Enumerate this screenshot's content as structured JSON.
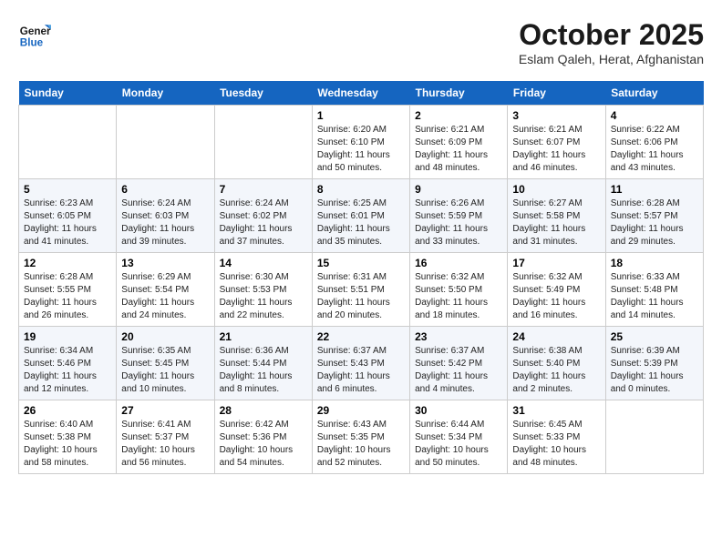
{
  "header": {
    "logo_general": "General",
    "logo_blue": "Blue",
    "title": "October 2025",
    "subtitle": "Eslam Qaleh, Herat, Afghanistan"
  },
  "days_of_week": [
    "Sunday",
    "Monday",
    "Tuesday",
    "Wednesday",
    "Thursday",
    "Friday",
    "Saturday"
  ],
  "weeks": [
    [
      {
        "day": "",
        "info": ""
      },
      {
        "day": "",
        "info": ""
      },
      {
        "day": "",
        "info": ""
      },
      {
        "day": "1",
        "info": "Sunrise: 6:20 AM\nSunset: 6:10 PM\nDaylight: 11 hours\nand 50 minutes."
      },
      {
        "day": "2",
        "info": "Sunrise: 6:21 AM\nSunset: 6:09 PM\nDaylight: 11 hours\nand 48 minutes."
      },
      {
        "day": "3",
        "info": "Sunrise: 6:21 AM\nSunset: 6:07 PM\nDaylight: 11 hours\nand 46 minutes."
      },
      {
        "day": "4",
        "info": "Sunrise: 6:22 AM\nSunset: 6:06 PM\nDaylight: 11 hours\nand 43 minutes."
      }
    ],
    [
      {
        "day": "5",
        "info": "Sunrise: 6:23 AM\nSunset: 6:05 PM\nDaylight: 11 hours\nand 41 minutes."
      },
      {
        "day": "6",
        "info": "Sunrise: 6:24 AM\nSunset: 6:03 PM\nDaylight: 11 hours\nand 39 minutes."
      },
      {
        "day": "7",
        "info": "Sunrise: 6:24 AM\nSunset: 6:02 PM\nDaylight: 11 hours\nand 37 minutes."
      },
      {
        "day": "8",
        "info": "Sunrise: 6:25 AM\nSunset: 6:01 PM\nDaylight: 11 hours\nand 35 minutes."
      },
      {
        "day": "9",
        "info": "Sunrise: 6:26 AM\nSunset: 5:59 PM\nDaylight: 11 hours\nand 33 minutes."
      },
      {
        "day": "10",
        "info": "Sunrise: 6:27 AM\nSunset: 5:58 PM\nDaylight: 11 hours\nand 31 minutes."
      },
      {
        "day": "11",
        "info": "Sunrise: 6:28 AM\nSunset: 5:57 PM\nDaylight: 11 hours\nand 29 minutes."
      }
    ],
    [
      {
        "day": "12",
        "info": "Sunrise: 6:28 AM\nSunset: 5:55 PM\nDaylight: 11 hours\nand 26 minutes."
      },
      {
        "day": "13",
        "info": "Sunrise: 6:29 AM\nSunset: 5:54 PM\nDaylight: 11 hours\nand 24 minutes."
      },
      {
        "day": "14",
        "info": "Sunrise: 6:30 AM\nSunset: 5:53 PM\nDaylight: 11 hours\nand 22 minutes."
      },
      {
        "day": "15",
        "info": "Sunrise: 6:31 AM\nSunset: 5:51 PM\nDaylight: 11 hours\nand 20 minutes."
      },
      {
        "day": "16",
        "info": "Sunrise: 6:32 AM\nSunset: 5:50 PM\nDaylight: 11 hours\nand 18 minutes."
      },
      {
        "day": "17",
        "info": "Sunrise: 6:32 AM\nSunset: 5:49 PM\nDaylight: 11 hours\nand 16 minutes."
      },
      {
        "day": "18",
        "info": "Sunrise: 6:33 AM\nSunset: 5:48 PM\nDaylight: 11 hours\nand 14 minutes."
      }
    ],
    [
      {
        "day": "19",
        "info": "Sunrise: 6:34 AM\nSunset: 5:46 PM\nDaylight: 11 hours\nand 12 minutes."
      },
      {
        "day": "20",
        "info": "Sunrise: 6:35 AM\nSunset: 5:45 PM\nDaylight: 11 hours\nand 10 minutes."
      },
      {
        "day": "21",
        "info": "Sunrise: 6:36 AM\nSunset: 5:44 PM\nDaylight: 11 hours\nand 8 minutes."
      },
      {
        "day": "22",
        "info": "Sunrise: 6:37 AM\nSunset: 5:43 PM\nDaylight: 11 hours\nand 6 minutes."
      },
      {
        "day": "23",
        "info": "Sunrise: 6:37 AM\nSunset: 5:42 PM\nDaylight: 11 hours\nand 4 minutes."
      },
      {
        "day": "24",
        "info": "Sunrise: 6:38 AM\nSunset: 5:40 PM\nDaylight: 11 hours\nand 2 minutes."
      },
      {
        "day": "25",
        "info": "Sunrise: 6:39 AM\nSunset: 5:39 PM\nDaylight: 11 hours\nand 0 minutes."
      }
    ],
    [
      {
        "day": "26",
        "info": "Sunrise: 6:40 AM\nSunset: 5:38 PM\nDaylight: 10 hours\nand 58 minutes."
      },
      {
        "day": "27",
        "info": "Sunrise: 6:41 AM\nSunset: 5:37 PM\nDaylight: 10 hours\nand 56 minutes."
      },
      {
        "day": "28",
        "info": "Sunrise: 6:42 AM\nSunset: 5:36 PM\nDaylight: 10 hours\nand 54 minutes."
      },
      {
        "day": "29",
        "info": "Sunrise: 6:43 AM\nSunset: 5:35 PM\nDaylight: 10 hours\nand 52 minutes."
      },
      {
        "day": "30",
        "info": "Sunrise: 6:44 AM\nSunset: 5:34 PM\nDaylight: 10 hours\nand 50 minutes."
      },
      {
        "day": "31",
        "info": "Sunrise: 6:45 AM\nSunset: 5:33 PM\nDaylight: 10 hours\nand 48 minutes."
      },
      {
        "day": "",
        "info": ""
      }
    ]
  ]
}
